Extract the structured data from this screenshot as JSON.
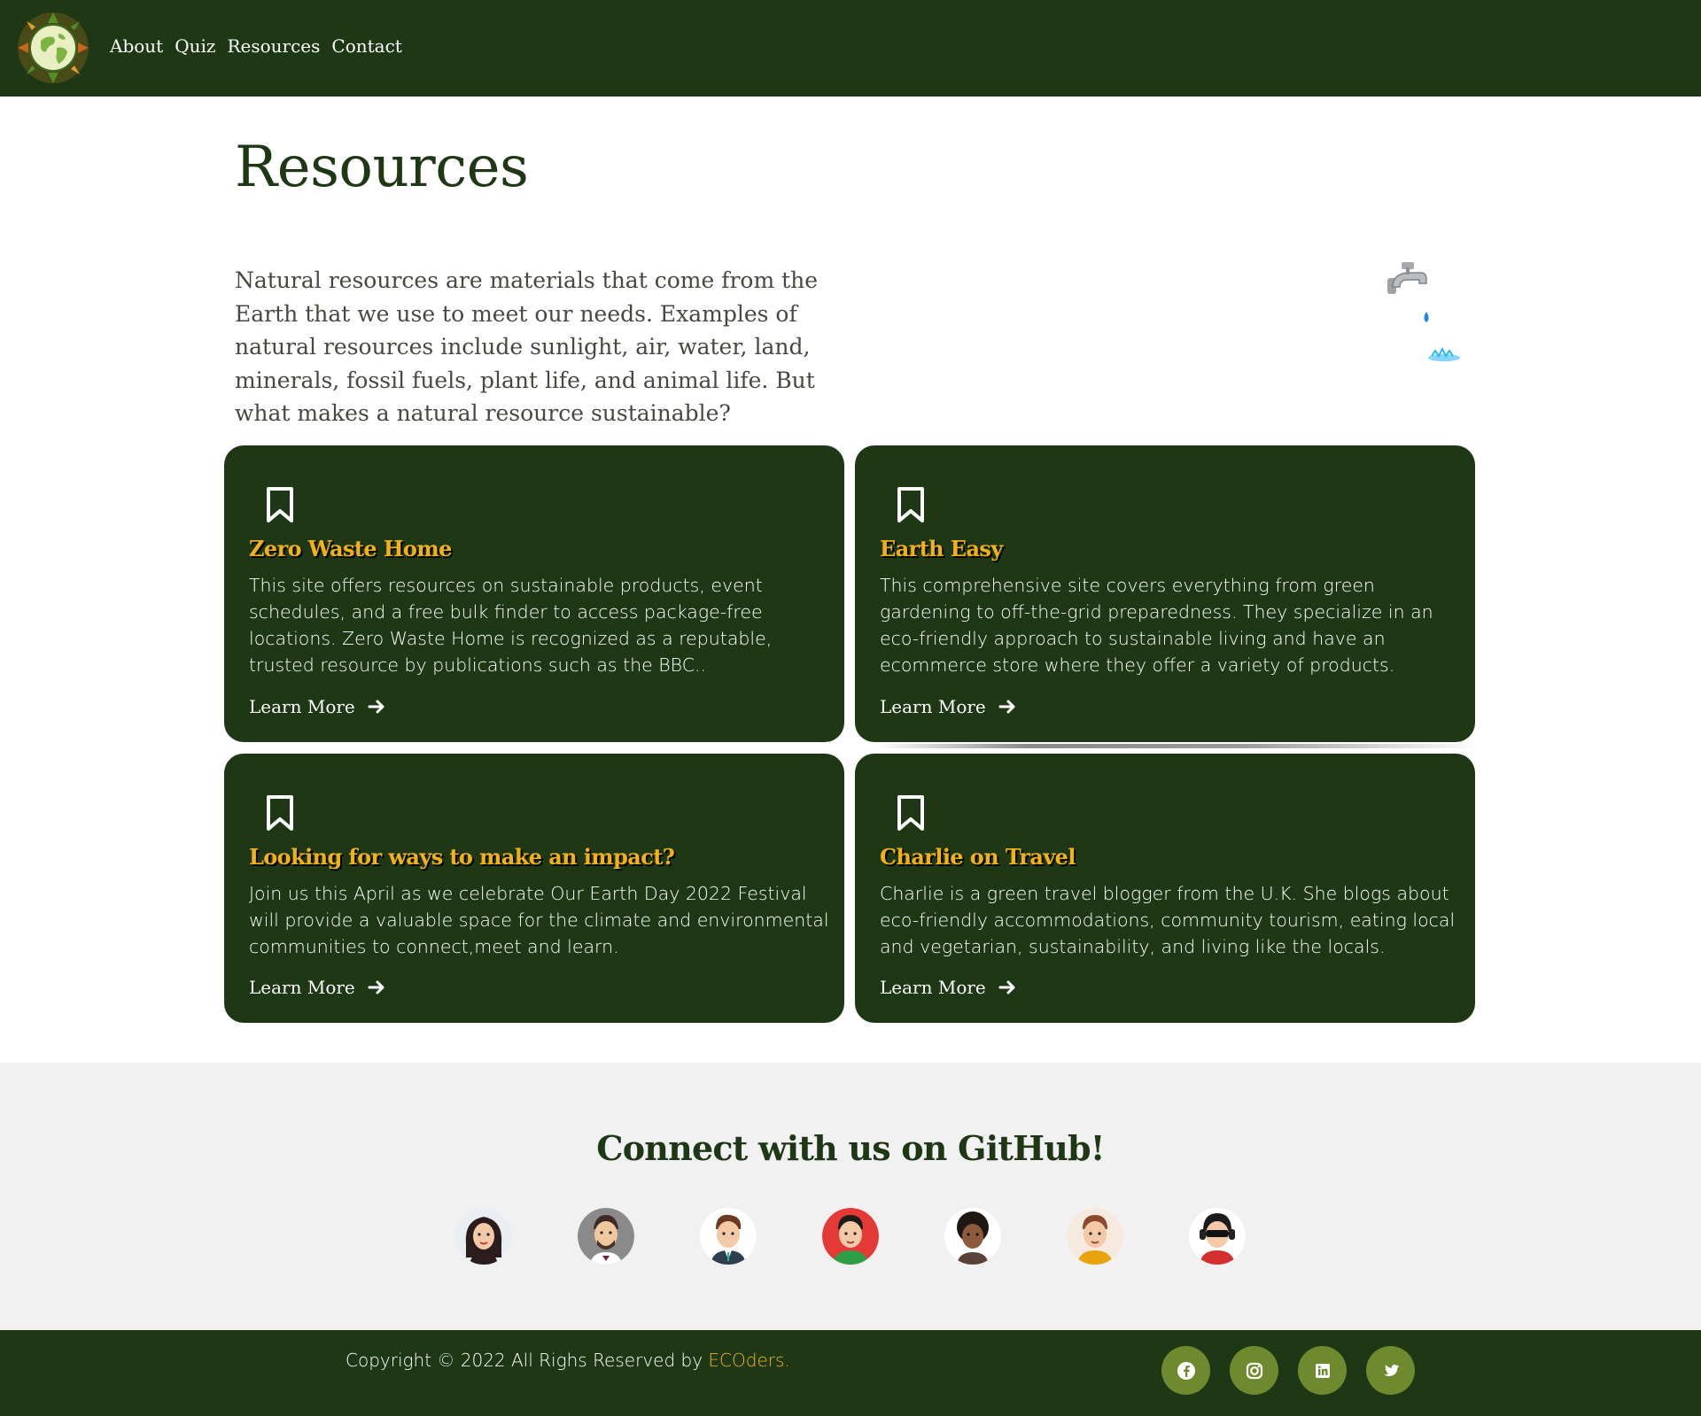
{
  "nav": {
    "links": [
      "About",
      "Quiz",
      "Resources",
      "Contact"
    ]
  },
  "page": {
    "title": "Resources",
    "intro": "Natural resources are materials that come from the Earth that we use to meet our needs. Examples of natural resources include sunlight, air, water, land, minerals, fossil fuels, plant life, and animal life. But what makes a natural resource sustainable?"
  },
  "cards": [
    {
      "title": "Zero Waste Home",
      "text": "This site offers resources on sustainable products, event schedules, and a free bulk finder to access package-free locations. Zero Waste Home is recognized as a reputable, trusted resource by publications such as the BBC..",
      "link": "Learn More"
    },
    {
      "title": "Earth Easy",
      "text": "This comprehensive site covers everything from green gardening to off-the-grid preparedness. They specialize in an eco-friendly approach to sustainable living and have an ecommerce store where they offer a variety of products.",
      "link": "Learn More"
    },
    {
      "title": "Looking for ways to make an impact?",
      "text": "Join us this April as we celebrate Our Earth Day 2022 Festival will provide a valuable space for the climate and environmental communities to connect,meet and learn.",
      "link": "Learn More"
    },
    {
      "title": "Charlie on Travel",
      "text": "Charlie is a green travel blogger from the U.K. She blogs about eco-friendly accommodations, community tourism, eating local and vegetarian, sustainability, and living like the locals.",
      "link": "Learn More"
    }
  ],
  "github": {
    "title": "Connect with us on GitHub!",
    "avatar_count": 7
  },
  "footer": {
    "copyright": "Copyright © 2022 All Righs Reserved by ",
    "brand": "ECOders.",
    "socials": [
      "facebook-icon",
      "instagram-icon",
      "linkedin-icon",
      "twitter-icon"
    ]
  },
  "colors": {
    "primary": "#1e3815",
    "accent": "#f2b215",
    "social_bg": "#6f8a2e",
    "section_bg": "#f1f1f1"
  }
}
